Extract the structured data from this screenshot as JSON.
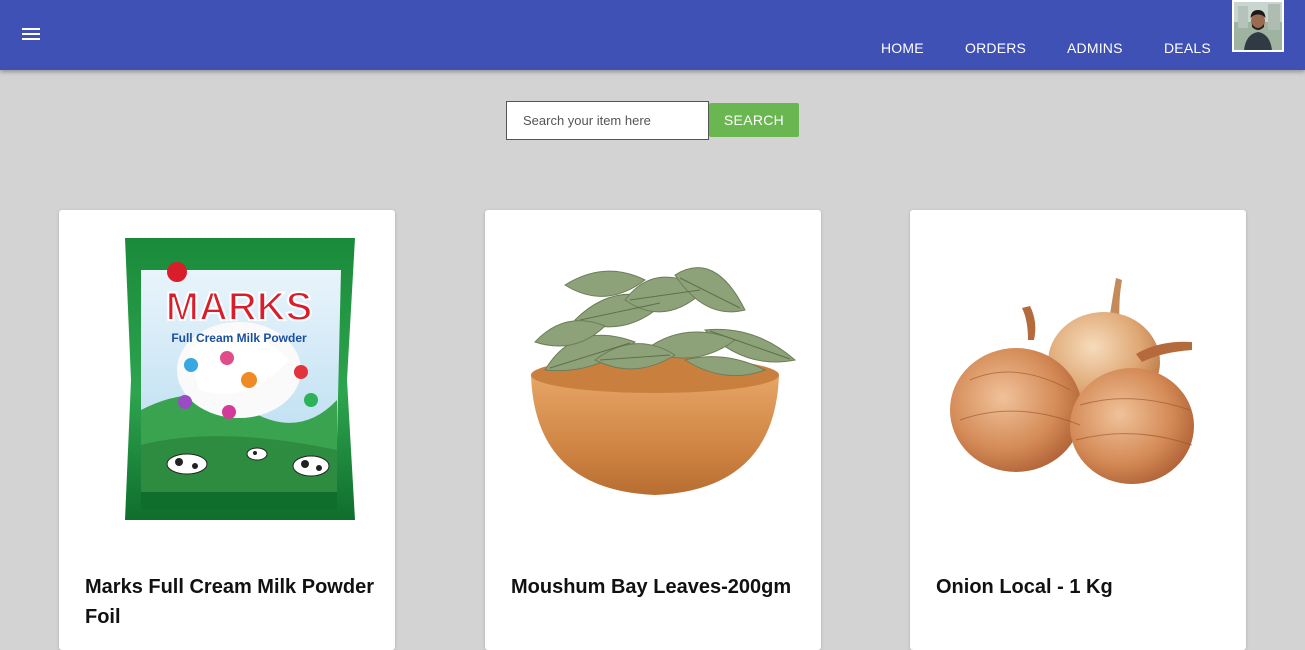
{
  "nav": {
    "items": [
      {
        "label": "HOME"
      },
      {
        "label": "ORDERS"
      },
      {
        "label": "ADMINS"
      },
      {
        "label": "DEALS"
      }
    ]
  },
  "search": {
    "placeholder": "Search your item here",
    "value": "",
    "button_label": "SEARCH"
  },
  "products": [
    {
      "title": "Marks Full Cream Milk Powder Foil",
      "image": "milk-powder-pack"
    },
    {
      "title": "Moushum Bay Leaves-200gm",
      "image": "bay-leaves-bowl"
    },
    {
      "title": "Onion Local - 1 Kg",
      "image": "onions"
    }
  ],
  "colors": {
    "appbar": "#3f51b5",
    "background": "#d3d3d3",
    "search_button": "#6ab752",
    "card": "#ffffff"
  }
}
